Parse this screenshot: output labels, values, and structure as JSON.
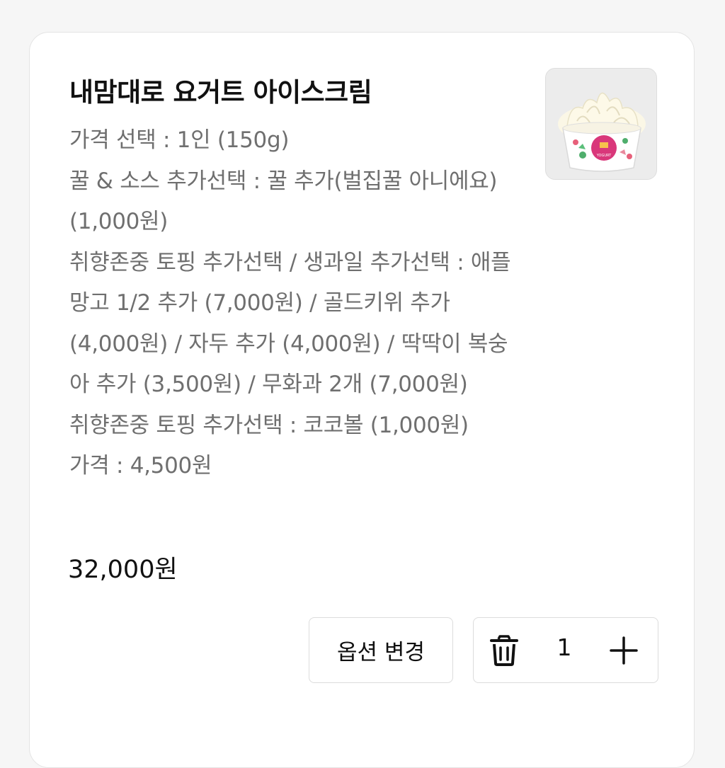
{
  "item": {
    "title": "내맘대로 요거트 아이스크림",
    "options": [
      "가격 선택 : 1인 (150g)",
      "꿀 & 소스 추가선택 : 꿀 추가(벌집꿀 아니에요) (1,000원)",
      "취향존중 토핑 추가선택 / 생과일 추가선택 : 애플망고 1/2 추가 (7,000원) / 골드키위 추가 (4,000원) / 자두 추가 (4,000원) / 딱딱이 복숭아 추가 (3,500원) / 무화과 2개 (7,000원)",
      "취향존중 토핑 추가선택 : 코코볼 (1,000원)",
      "가격 : 4,500원"
    ],
    "total_price": "32,000원",
    "image_label": "YOGURT",
    "change_option_label": "옵션 변경",
    "quantity": "1",
    "icons": {
      "delete": "trash-icon",
      "increase": "plus-icon"
    }
  }
}
